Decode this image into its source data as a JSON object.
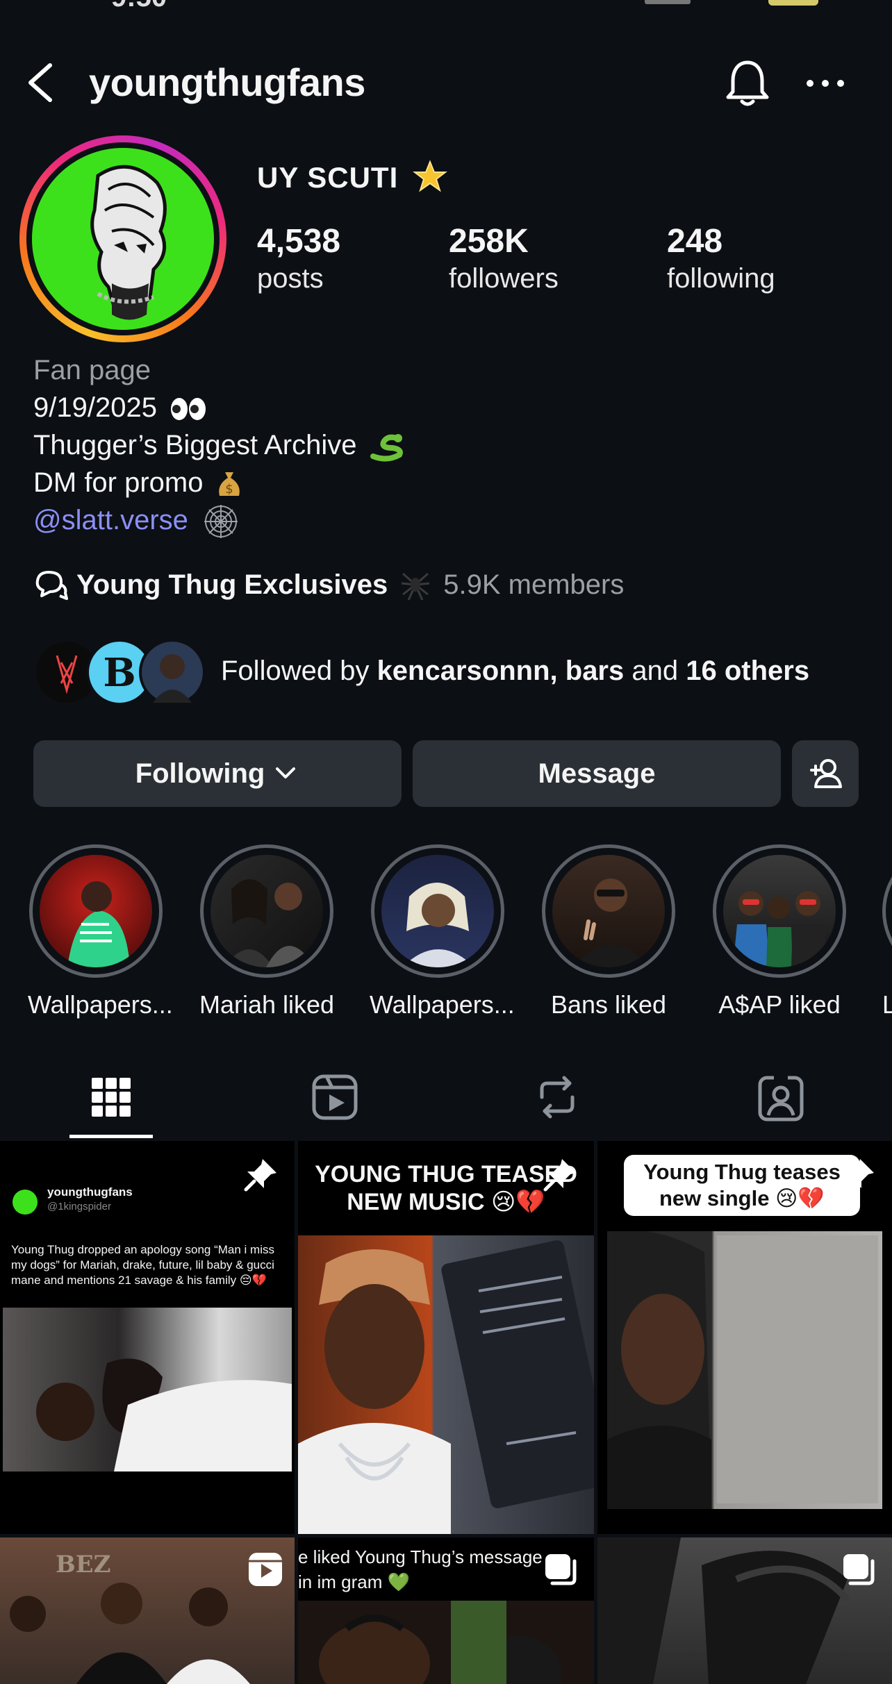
{
  "header": {
    "username": "youngthugfans"
  },
  "profile": {
    "display_name": "UY SCUTI",
    "stats": [
      {
        "value": "4,538",
        "label": "posts"
      },
      {
        "value": "258K",
        "label": "followers"
      },
      {
        "value": "248",
        "label": "following"
      }
    ],
    "bio": {
      "category": "Fan page",
      "line1": "9/19/2025",
      "line2": "Thugger’s Biggest Archive",
      "line3": "DM for promo",
      "link": "@slatt.verse"
    },
    "channel": {
      "name": "Young Thug Exclusives",
      "members": "5.9K members"
    },
    "followed_by": {
      "prefix": "Followed by ",
      "names": "kencarsonnn, bars",
      "and": " and ",
      "others": "16 others"
    }
  },
  "buttons": {
    "following": "Following",
    "message": "Message"
  },
  "highlights": [
    {
      "label": "Wallpapers..."
    },
    {
      "label": "Mariah liked"
    },
    {
      "label": "Wallpapers..."
    },
    {
      "label": "Bans liked"
    },
    {
      "label": "A$AP liked"
    },
    {
      "label": "LC"
    }
  ],
  "posts": {
    "p1": {
      "account": "youngthugfans",
      "handle": "@1kingspider",
      "caption": "Young Thug dropped an apology song “Man i miss my dogs” for Mariah, drake, future, lil baby & gucci mane and mentions 21 savage & his family 😔💔"
    },
    "p2": {
      "headline": "YOUNG THUG TEASED NEW MUSIC 😢💔"
    },
    "p3": {
      "headline": "Young Thug teases new single 😢💔"
    },
    "p5": {
      "caption": "e liked Young Thug’s message in im gram 💚"
    }
  },
  "colors": {
    "accent_link": "#8b8ff4",
    "avatar_bg": "#3de11b",
    "button_bg": "#2b3036"
  }
}
